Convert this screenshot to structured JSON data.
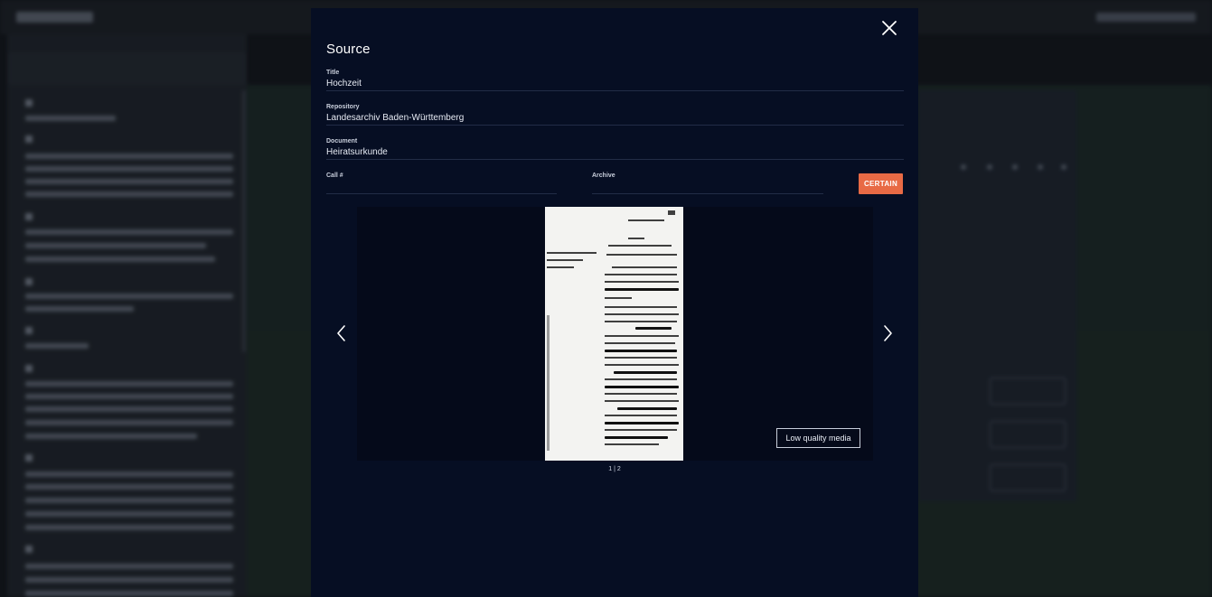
{
  "modal": {
    "title": "Source",
    "fields": {
      "title": {
        "label": "Title",
        "value": "Hochzeit"
      },
      "repository": {
        "label": "Repository",
        "value": "Landesarchiv Baden-Württemberg"
      },
      "document": {
        "label": "Document",
        "value": "Heiratsurkunde"
      },
      "call_number": {
        "label": "Call #",
        "value": ""
      },
      "archive": {
        "label": "Archive",
        "value": ""
      }
    },
    "certainty_button": "CERTAIN",
    "media": {
      "badge": "Low quality media",
      "pager": "1 | 2"
    },
    "icons": {
      "close": "close-icon",
      "prev": "chevron-left-icon",
      "next": "chevron-right-icon"
    }
  },
  "colors": {
    "modal_bg": "#060e23",
    "accent": "#e86a45",
    "field_divider": "#222c46",
    "viewer_bg": "#050a1a"
  }
}
